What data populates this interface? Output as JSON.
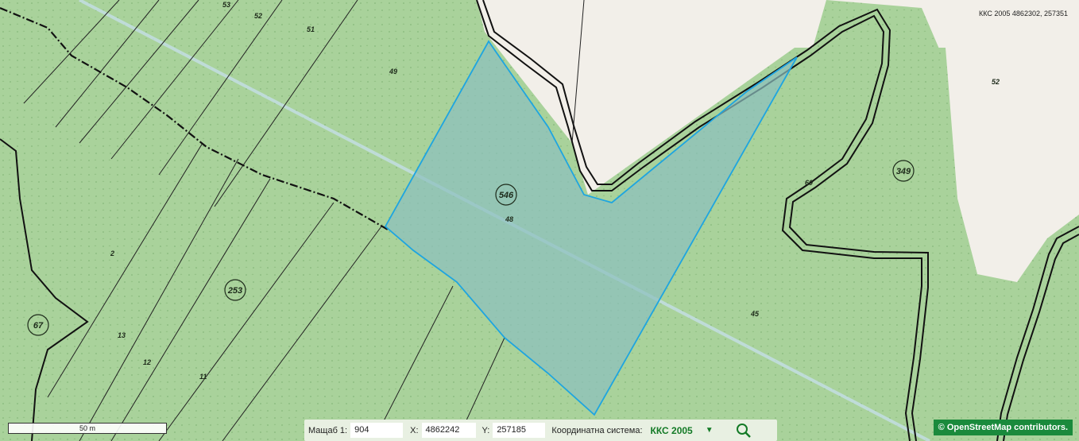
{
  "header": {
    "coordinates": "ККС 2005 4862302, 257351"
  },
  "map": {
    "parcel_labels": [
      "53",
      "52",
      "51",
      "49",
      "48",
      "2",
      "13",
      "12",
      "11",
      "45",
      "60",
      "52"
    ],
    "circle_labels": [
      "546",
      "253",
      "67",
      "349"
    ]
  },
  "scale": {
    "label": "50 m"
  },
  "toolbar": {
    "scale_label": "Мащаб 1:",
    "scale_value": "904",
    "x_label": "X:",
    "x_value": "4862242",
    "y_label": "Y:",
    "y_value": "257185",
    "cs_label": "Координатна система:",
    "cs_value": "ККС 2005"
  },
  "attribution": {
    "text": "© OpenStreetMap contributors."
  },
  "colors": {
    "forest": "#a9d29b",
    "clearing": "#f2efe9",
    "selection_fill": "#8cbfbf",
    "selection_stroke": "#1ea5e0",
    "osm_badge": "#1a8a3c",
    "cs_text": "#137a26"
  },
  "icons": [
    "search-icon",
    "dropdown-arrow-icon"
  ]
}
